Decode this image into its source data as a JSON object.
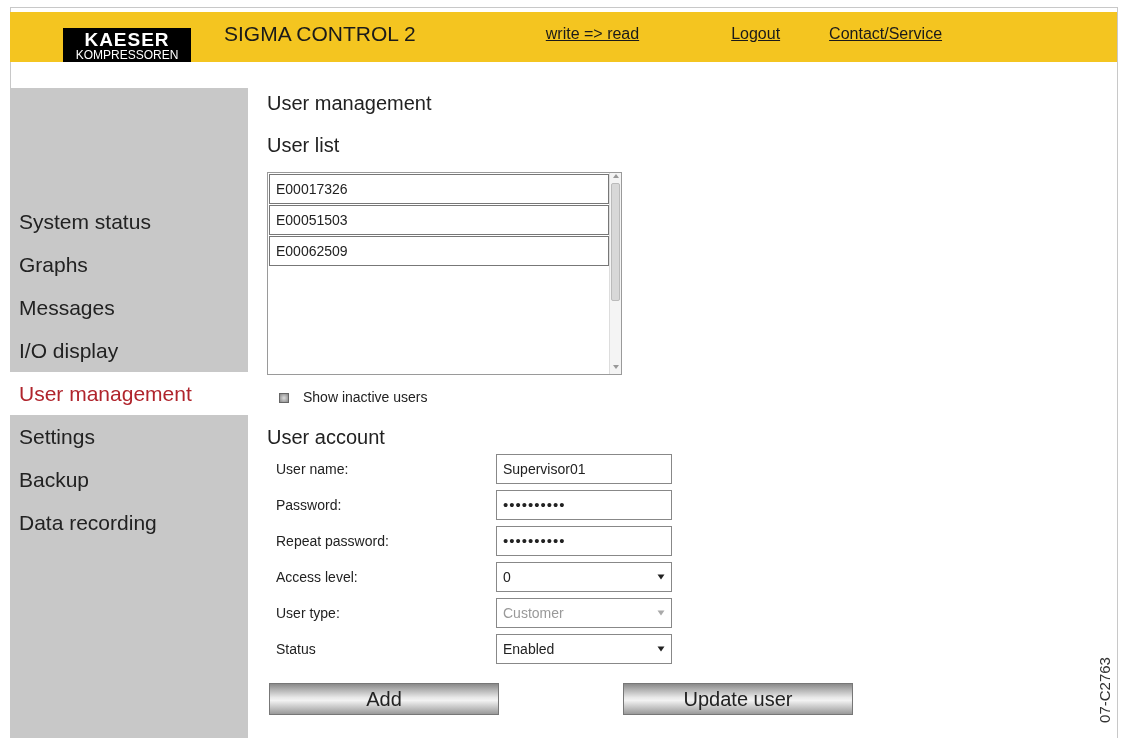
{
  "header": {
    "logo": {
      "line_1": "KAESER",
      "line_2": "KOMPRESSOREN"
    },
    "title": "SIGMA CONTROL 2",
    "links": [
      "write => read",
      "Logout",
      "Contact/Service"
    ]
  },
  "sidebar": {
    "items": [
      {
        "label": "System status",
        "selected": false
      },
      {
        "label": "Graphs",
        "selected": false
      },
      {
        "label": "Messages",
        "selected": false
      },
      {
        "label": "I/O display",
        "selected": false
      },
      {
        "label": "User management",
        "selected": true
      },
      {
        "label": "Settings",
        "selected": false
      },
      {
        "label": "Backup",
        "selected": false
      },
      {
        "label": "Data recording",
        "selected": false
      }
    ]
  },
  "page_title": "User management",
  "user_list": {
    "heading": "User list",
    "users": [
      {
        "label": "E00017326",
        "selected": false
      },
      {
        "label": "E00051503",
        "selected": false
      },
      {
        "label": "E00062509",
        "selected": false
      }
    ],
    "show_inactive": {
      "label": "Show inactive users",
      "checked": false
    }
  },
  "user_account": {
    "heading": "User account",
    "fields": [
      {
        "label": "User name:",
        "kind": "text",
        "value": "Supervisor01",
        "disabled": false
      },
      {
        "label": "Password:",
        "kind": "password",
        "value": "••••••••••",
        "disabled": false
      },
      {
        "label": "Repeat password:",
        "kind": "password",
        "value": "••••••••••",
        "disabled": false
      },
      {
        "label": "Access level:",
        "kind": "select",
        "value": "0",
        "disabled": false
      },
      {
        "label": "User type:",
        "kind": "select",
        "value": "Customer",
        "disabled": true
      },
      {
        "label": "Status",
        "kind": "select",
        "value": "Enabled",
        "disabled": false
      }
    ],
    "buttons": [
      "Add",
      "Update user"
    ]
  },
  "figure_number": "07-C2763"
}
